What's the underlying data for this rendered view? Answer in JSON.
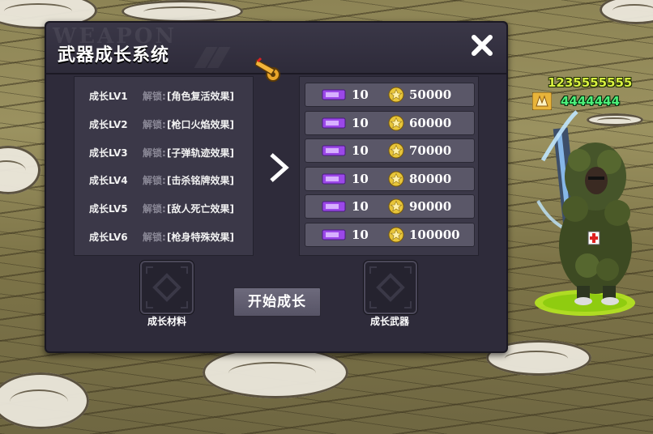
{
  "panel": {
    "title": "武器成长系统",
    "watermark": "WEAPON"
  },
  "levels": [
    {
      "name": "成长LV1",
      "unlock": "解锁:",
      "effect": "[角色复活效果]"
    },
    {
      "name": "成长LV2",
      "unlock": "解锁:",
      "effect": "[枪口火焰效果]"
    },
    {
      "name": "成长LV3",
      "unlock": "解锁:",
      "effect": "[子弹轨迹效果]"
    },
    {
      "name": "成长LV4",
      "unlock": "解锁:",
      "effect": "[击杀铭牌效果]"
    },
    {
      "name": "成长LV5",
      "unlock": "解锁:",
      "effect": "[敌人死亡效果]"
    },
    {
      "name": "成长LV6",
      "unlock": "解锁:",
      "effect": "[枪身特殊效果]"
    }
  ],
  "costs": [
    {
      "tickets": "10",
      "coins": "50000"
    },
    {
      "tickets": "10",
      "coins": "60000"
    },
    {
      "tickets": "10",
      "coins": "70000"
    },
    {
      "tickets": "10",
      "coins": "80000"
    },
    {
      "tickets": "10",
      "coins": "90000"
    },
    {
      "tickets": "10",
      "coins": "100000"
    }
  ],
  "slots": {
    "material_label": "成长材料",
    "weapon_label": "成长武器"
  },
  "buttons": {
    "start": "开始成长"
  },
  "player": {
    "gold_stat": "1235555555",
    "green_stat": "4444444"
  },
  "icons": {
    "close": "close-icon",
    "arrow": "chevron-right-icon",
    "ticket": "ticket-icon",
    "coin": "star-coin-icon",
    "weapon": "golden-cannon-icon",
    "rank": "rank-badge-icon"
  },
  "colors": {
    "panel_bg": "#2e2b3a",
    "row_bg": "#5a5768",
    "unlock_text": "#8a8896",
    "gold_stat": "#d8f040",
    "green_stat": "#4cf07a",
    "ticket": "#9b48e8",
    "coin": "#e7c53a"
  }
}
